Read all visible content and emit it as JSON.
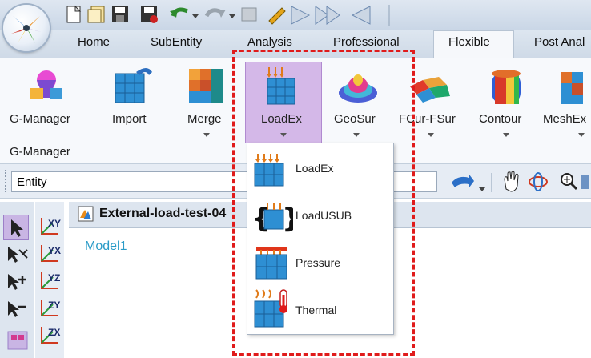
{
  "ribbon_tabs": [
    "Home",
    "SubEntity",
    "Analysis",
    "Professional",
    "Flexible",
    "Post Anal"
  ],
  "active_tab": "Flexible",
  "ribbon_buttons": {
    "gmanager": "G-Manager",
    "import": "Import",
    "merge": "Merge",
    "loadex": "LoadEx",
    "geosur": "GeoSur",
    "fcur": "FCur-FSur",
    "contour": "Contour",
    "meshex": "MeshEx"
  },
  "group_label": "G-Manager",
  "entity_field": "Entity",
  "document": {
    "title": "External-load-test-04",
    "model_label": "Model1"
  },
  "dropdown_menu": {
    "items": [
      "LoadEx",
      "LoadUSUB",
      "Pressure",
      "Thermal"
    ]
  },
  "axis_buttons": [
    "XY",
    "YX",
    "YZ",
    "ZY",
    "ZX"
  ],
  "colors": {
    "highlight": "#d4b8e8",
    "annotation": "#e01b1b",
    "model_text": "#2a9bc7"
  }
}
